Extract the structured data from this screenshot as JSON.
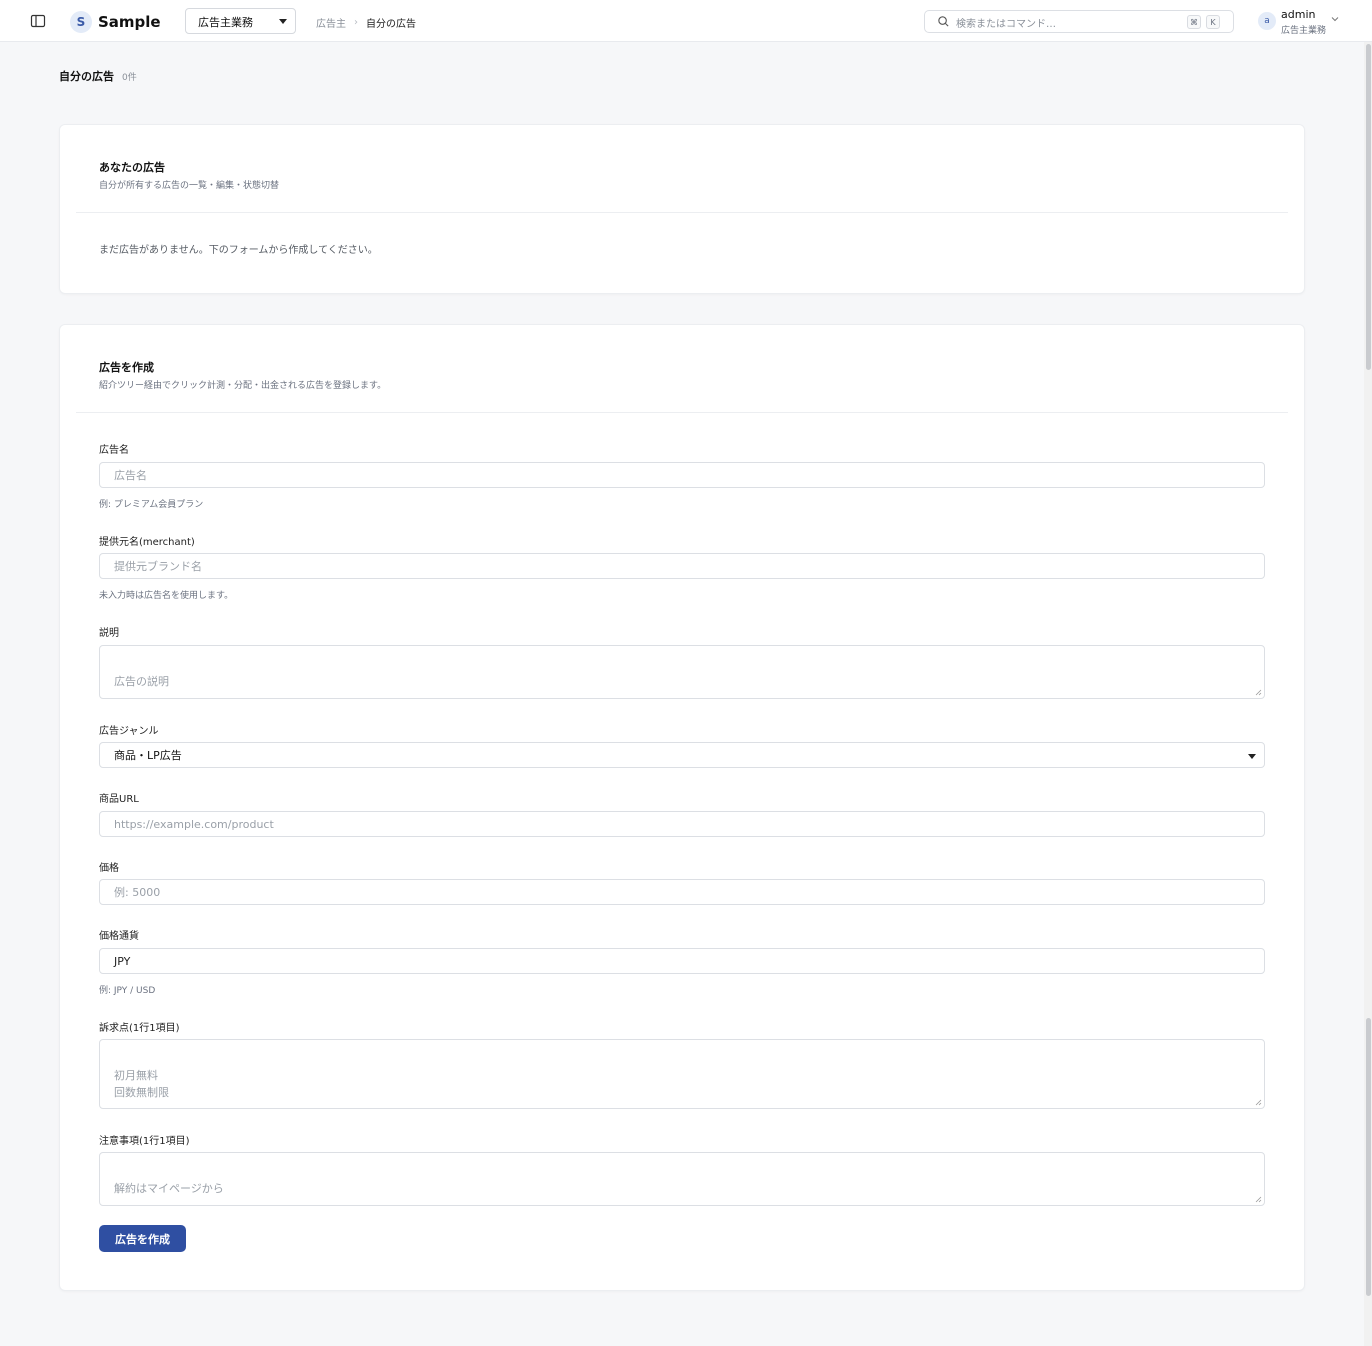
{
  "header": {
    "logo_letter": "S",
    "app_name": "Sample",
    "role_select": "広告主業務",
    "breadcrumb": [
      "広告主",
      "自分の広告"
    ],
    "breadcrumb_separator": "›",
    "search_placeholder": "検索またはコマンド…",
    "shortcut_keys": [
      "⌘",
      "K"
    ],
    "user": {
      "avatar_letter": "a",
      "name": "admin",
      "role": "広告主業務"
    }
  },
  "page": {
    "title": "自分の広告",
    "count": "0件"
  },
  "ads_card": {
    "title": "あなたの広告",
    "subtitle": "自分が所有する広告の一覧・編集・状態切替",
    "empty_message": "まだ広告がありません。下のフォームから作成してください。"
  },
  "create_card": {
    "title": "広告を作成",
    "subtitle": "紹介ツリー経由でクリック計測・分配・出金される広告を登録します。",
    "fields": {
      "name": {
        "label": "広告名",
        "placeholder": "広告名",
        "help": "例: プレミアム会員プラン"
      },
      "merchant": {
        "label": "提供元名(merchant)",
        "placeholder": "提供元ブランド名",
        "help": "未入力時は広告名を使用します。"
      },
      "description": {
        "label": "説明",
        "placeholder": "広告の説明"
      },
      "genre": {
        "label": "広告ジャンル",
        "value": "商品・LP広告"
      },
      "product_url": {
        "label": "商品URL",
        "placeholder": "https://example.com/product"
      },
      "price": {
        "label": "価格",
        "placeholder": "例: 5000"
      },
      "currency": {
        "label": "価格通貨",
        "value": "JPY",
        "help": "例: JPY / USD"
      },
      "appeal_points": {
        "label": "訴求点(1行1項目)",
        "placeholder": "初月無料\n回数無制限"
      },
      "notes": {
        "label": "注意事項(1行1項目)",
        "placeholder": "解約はマイページから"
      }
    },
    "submit_label": "広告を作成"
  },
  "colors": {
    "primary": "#2f4fa2",
    "background": "#f6f7f9",
    "avatar_bg": "#e3ebf8"
  }
}
